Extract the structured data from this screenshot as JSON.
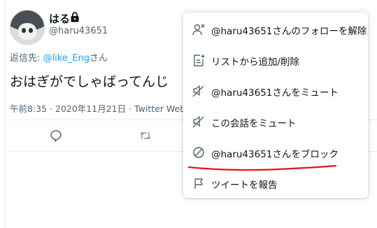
{
  "tweet": {
    "display_name": "はる",
    "handle": "@haru43651",
    "reply_prefix": "返信先: ",
    "reply_target": "@like_Eng",
    "reply_suffix": "さん",
    "text": "おはぎがでしゃばってんじ",
    "timestamp": "午前8:35 · 2020年11月21日 · Twitter Web"
  },
  "menu": {
    "items": [
      {
        "label": "@haru43651さんのフォローを解除",
        "icon": "unfollow-icon"
      },
      {
        "label": "リストから追加/削除",
        "icon": "list-add-icon"
      },
      {
        "label": "@haru43651さんをミュート",
        "icon": "mute-icon"
      },
      {
        "label": "この会話をミュート",
        "icon": "mute-conversation-icon"
      },
      {
        "label": "@haru43651さんをブロック",
        "icon": "block-icon"
      },
      {
        "label": "ツイートを報告",
        "icon": "report-flag-icon"
      }
    ]
  },
  "colors": {
    "link": "#1d9bf0",
    "secondary_text": "#536471",
    "annotation_underline": "#e0151b"
  }
}
